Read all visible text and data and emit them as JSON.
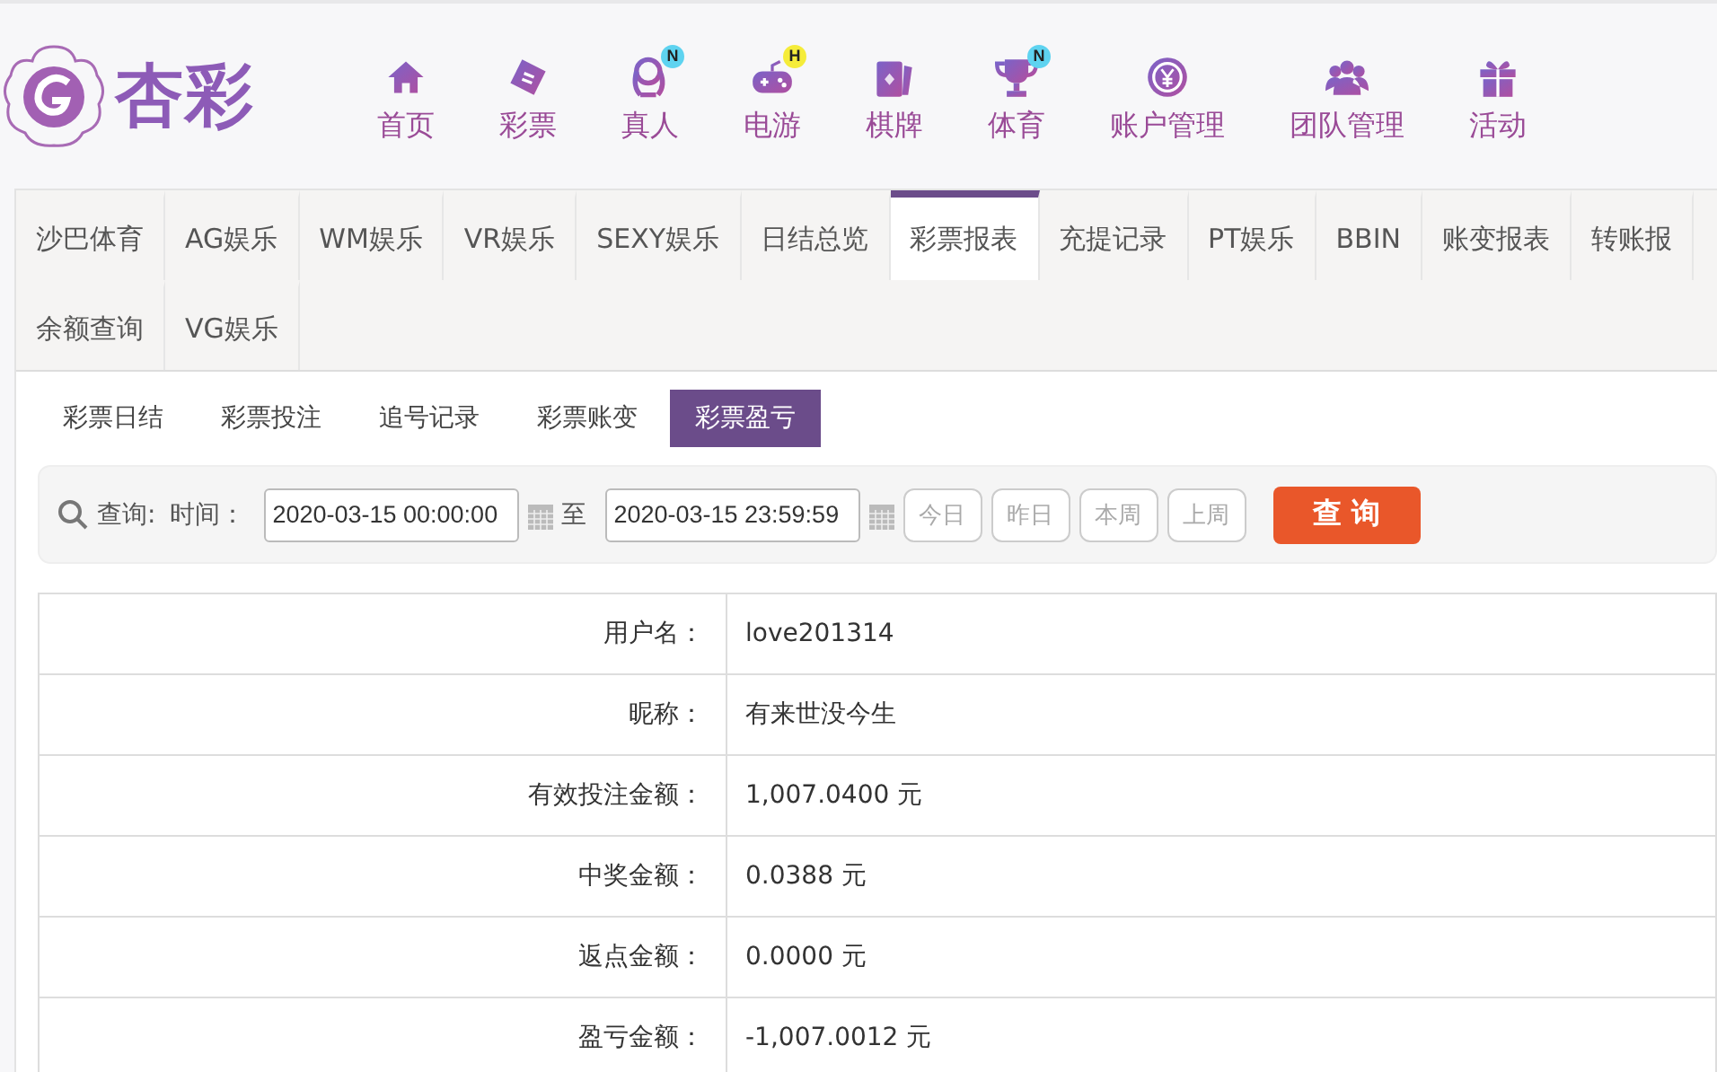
{
  "logo": {
    "text": "杏彩"
  },
  "nav": [
    {
      "label": "首页"
    },
    {
      "label": "彩票"
    },
    {
      "label": "真人",
      "badge": "N"
    },
    {
      "label": "电游",
      "badge": "H"
    },
    {
      "label": "棋牌"
    },
    {
      "label": "体育",
      "badge": "N"
    },
    {
      "label": "账户管理"
    },
    {
      "label": "团队管理"
    },
    {
      "label": "活动"
    }
  ],
  "tabs": [
    {
      "label": "沙巴体育",
      "selected": false
    },
    {
      "label": "AG娱乐",
      "selected": false
    },
    {
      "label": "WM娱乐",
      "selected": false
    },
    {
      "label": "VR娱乐",
      "selected": false
    },
    {
      "label": "SEXY娱乐",
      "selected": false
    },
    {
      "label": "日结总览",
      "selected": false
    },
    {
      "label": "彩票报表",
      "selected": true
    },
    {
      "label": "充提记录",
      "selected": false
    },
    {
      "label": "PT娱乐",
      "selected": false
    },
    {
      "label": "BBIN",
      "selected": false
    },
    {
      "label": "账变报表",
      "selected": false
    },
    {
      "label": "转账报",
      "selected": false
    },
    {
      "label": "余额查询",
      "selected": false
    },
    {
      "label": "VG娱乐",
      "selected": false
    }
  ],
  "subtabs": [
    {
      "label": "彩票日结",
      "selected": false
    },
    {
      "label": "彩票投注",
      "selected": false
    },
    {
      "label": "追号记录",
      "selected": false
    },
    {
      "label": "彩票账变",
      "selected": false
    },
    {
      "label": "彩票盈亏",
      "selected": true
    }
  ],
  "query": {
    "label": "查询:",
    "time_label": "时间：",
    "start": "2020-03-15 00:00:00",
    "separator": "至",
    "end": "2020-03-15 23:59:59",
    "quick": [
      "今日",
      "昨日",
      "本周",
      "上周"
    ],
    "submit": "查 询"
  },
  "table": [
    {
      "label": "用户名：",
      "value": "love201314"
    },
    {
      "label": "昵称：",
      "value": "有来世没今生"
    },
    {
      "label": "有效投注金额：",
      "value": "1,007.0400 元"
    },
    {
      "label": "中奖金额：",
      "value": "0.0388 元"
    },
    {
      "label": "返点金额：",
      "value": "0.0000 元"
    },
    {
      "label": "盈亏金额：",
      "value": "-1,007.0012 元"
    }
  ]
}
